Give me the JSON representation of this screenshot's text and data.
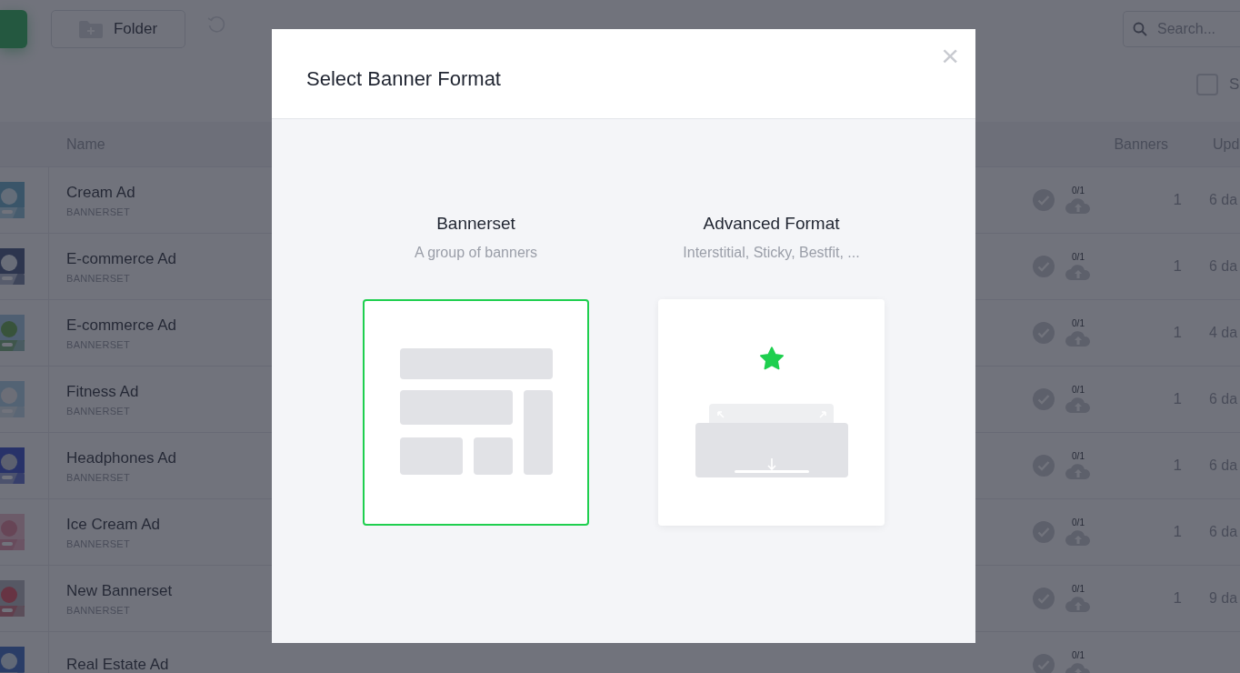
{
  "toolbar": {
    "folder_button": "Folder",
    "search": {
      "placeholder": "Search..."
    },
    "select_all": {
      "label": "S",
      "checked": false
    }
  },
  "table": {
    "columns": [
      "Name",
      "Banners",
      "Upd"
    ],
    "rows": [
      {
        "name": "Cream Ad",
        "type": "BANNERSET",
        "status": "0/1",
        "banners": "1",
        "updated": "6 da"
      },
      {
        "name": "E-commerce Ad",
        "type": "BANNERSET",
        "status": "0/1",
        "banners": "1",
        "updated": "6 da"
      },
      {
        "name": "E-commerce Ad",
        "type": "BANNERSET",
        "status": "0/1",
        "banners": "1",
        "updated": "4 da"
      },
      {
        "name": "Fitness Ad",
        "type": "BANNERSET",
        "status": "0/1",
        "banners": "1",
        "updated": "6 da"
      },
      {
        "name": "Headphones Ad",
        "type": "BANNERSET",
        "status": "0/1",
        "banners": "1",
        "updated": "6 da"
      },
      {
        "name": "Ice Cream Ad",
        "type": "BANNERSET",
        "status": "0/1",
        "banners": "1",
        "updated": "6 da"
      },
      {
        "name": "New Bannerset",
        "type": "BANNERSET",
        "status": "0/1",
        "banners": "1",
        "updated": "9 da"
      },
      {
        "name": "Real Estate Ad",
        "status": "0/1"
      }
    ]
  },
  "dialog": {
    "title": "Select Banner Format",
    "close": "×",
    "options": [
      {
        "kind": "layout",
        "title": "Bannerset",
        "subtitle": "A group of banners",
        "selected": true
      },
      {
        "kind": "advanced",
        "title": "Advanced Format",
        "subtitle": "Interstitial, Sticky, Bestfit, ...",
        "selected": false
      }
    ]
  }
}
